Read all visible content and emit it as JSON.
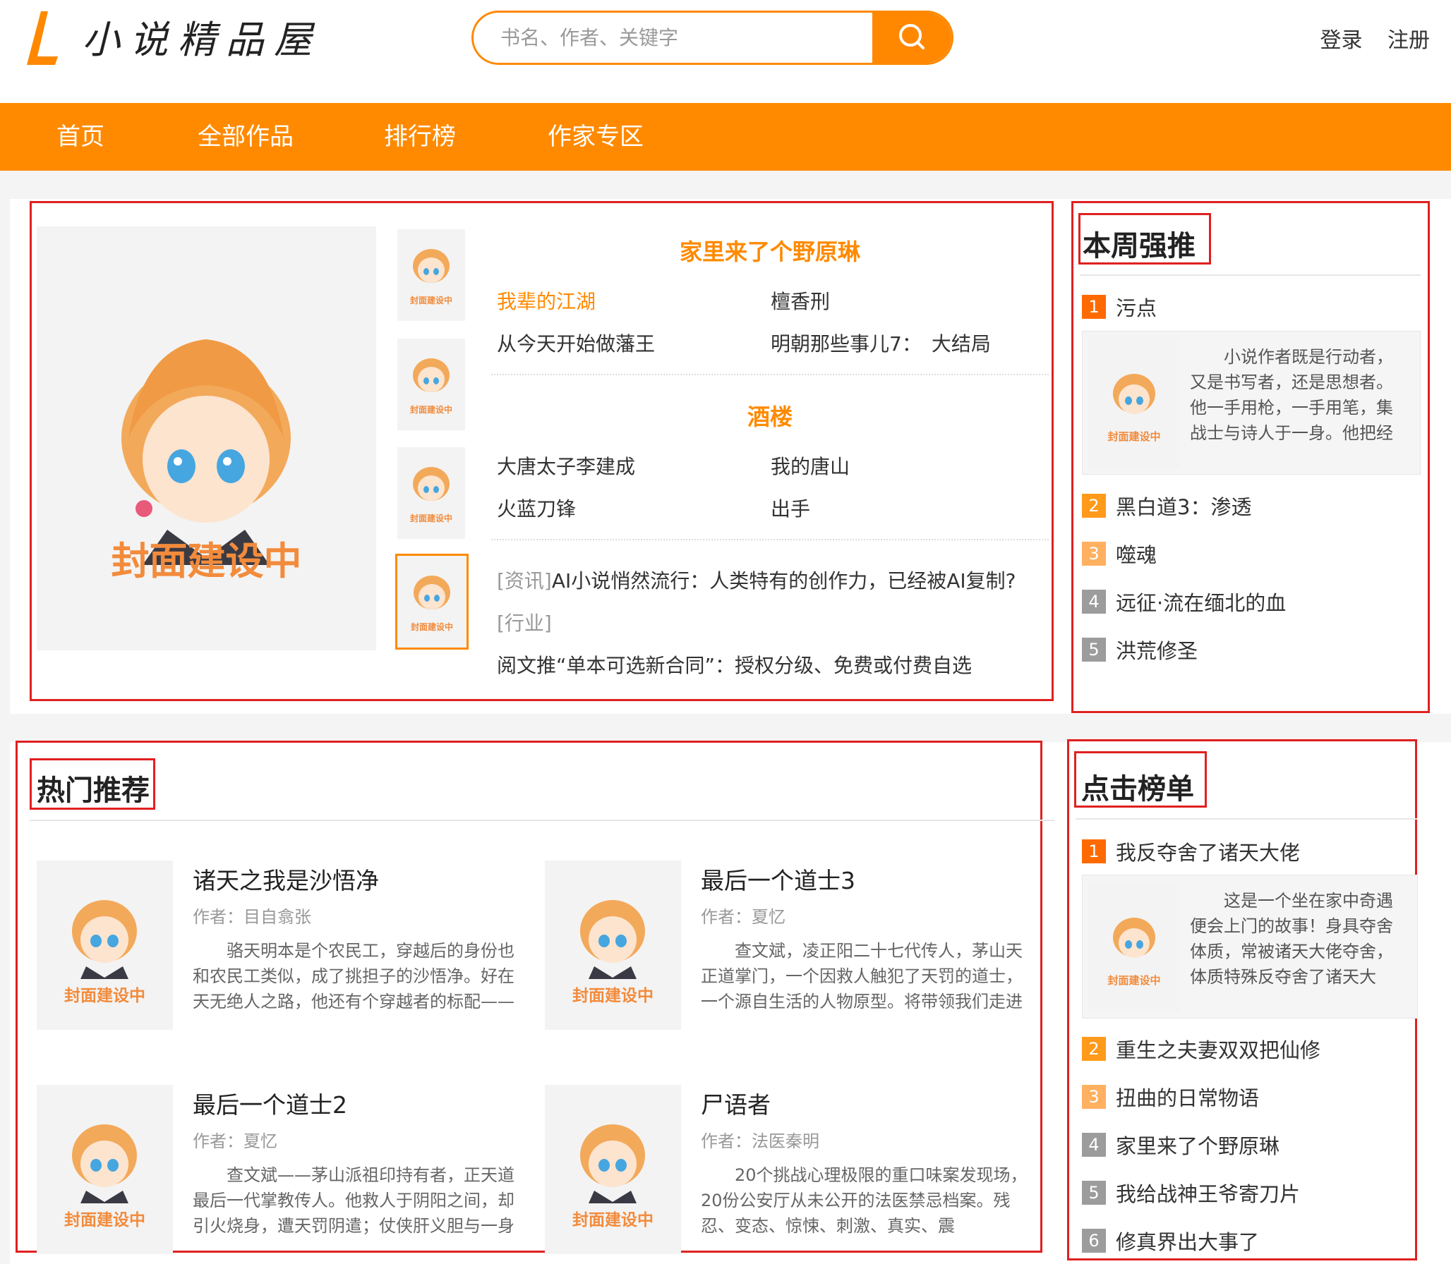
{
  "site": {
    "name": "小说精品屋"
  },
  "search": {
    "placeholder": "书名、作者、关键字"
  },
  "header_links": {
    "login": "登录",
    "register": "注册"
  },
  "nav": [
    "首页",
    "全部作品",
    "排行榜",
    "作家专区"
  ],
  "cover_placeholder": {
    "large": "封面建设中",
    "small": "封面建设中"
  },
  "featured": {
    "group1": {
      "title": "家里来了个野原琳",
      "links": [
        "我辈的江湖",
        "檀香刑",
        "从今天开始做藩王",
        "明朝那些事儿7：　大结局"
      ]
    },
    "group2": {
      "title": "酒楼",
      "links": [
        "大唐太子李建成",
        "我的唐山",
        "火蓝刀锋",
        "出手"
      ]
    },
    "news": [
      {
        "tag": "[资讯]",
        "text": "AI小说悄然流行：人类特有的创作力，已经被AI复制?"
      },
      {
        "tag": "[行业]",
        "text": ""
      },
      {
        "tag": "",
        "text": "阅文推“单本可选新合同”：授权分级、免费或付费自选"
      }
    ]
  },
  "weekly": {
    "title": "本周强推",
    "first": "污点",
    "first_desc": "小说作者既是行动者，又是书写者，还是思想者。他一手用枪，一手用笔，集战士与诗人于一身。他把经",
    "items": [
      "黑白道3：渗透",
      "噬魂",
      "远征·流在缅北的血",
      "洪荒修圣"
    ]
  },
  "hot": {
    "title": "热门推荐",
    "books": [
      {
        "title": "诸天之我是沙悟净",
        "author": "作者：目自翕张",
        "desc": "骆天明本是个农民工，穿越后的身份也和农民工类似，成了挑担子的沙悟净。好在天无绝人之路，他还有个穿越者的标配——"
      },
      {
        "title": "最后一个道士3",
        "author": "作者：夏忆",
        "desc": "查文斌，凌正阳二十七代传人，茅山天正道掌门，一个因救人触犯了天罚的道士，一个源自生活的人物原型。将带领我们走进"
      },
      {
        "title": "最后一个道士2",
        "author": "作者：夏忆",
        "desc": "查文斌——茅山派祖印持有者，正天道最后一代掌教传人。他救人于阴阳之间，却引火烧身，遭天罚阴遣；仗侠肝义胆与一身"
      },
      {
        "title": "尸语者",
        "author": "作者：法医秦明",
        "desc": "20个挑战心理极限的重口味案发现场，20份公安厅从未公开的法医禁忌档案。残忍、变态、惊悚、刺激、真实、震"
      }
    ]
  },
  "clicks": {
    "title": "点击榜单",
    "first": "我反夺舍了诸天大佬",
    "first_desc": "这是一个坐在家中奇遇便会上门的故事！身具夺舍体质，常被诸天大佬夺舍，体质特殊反夺舍了诸天大",
    "items": [
      "重生之夫妻双双把仙修",
      "扭曲的日常物语",
      "家里来了个野原琳",
      "我给战神王爷寄刀片",
      "修真界出大事了"
    ]
  },
  "colors": {
    "accent": "#ff8a00",
    "highlight_box": "#e02020"
  }
}
